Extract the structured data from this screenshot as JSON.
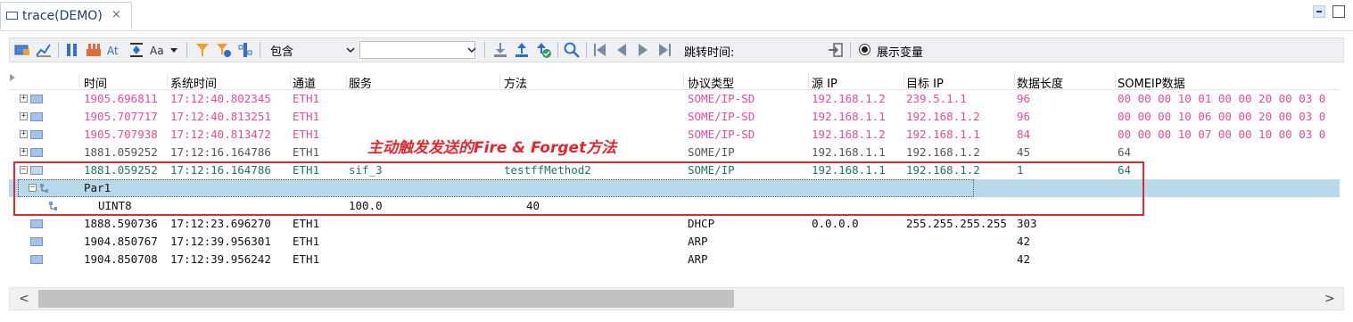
{
  "tab": {
    "title": "trace(DEMO)",
    "close": "×"
  },
  "toolbar": {
    "filter_mode": "包含",
    "search_value": "",
    "jump_label": "跳转时间:",
    "show_vars_label": "展示变量"
  },
  "table": {
    "columns": [
      "时间",
      "系统时间",
      "通道",
      "服务",
      "方法",
      "协议类型",
      "源 IP",
      "目标 IP",
      "数据长度",
      "SOMEIP数据"
    ],
    "rows": [
      {
        "time": "1905.696811",
        "sys": "17:12:40.802345",
        "ch": "ETH1",
        "svc": "",
        "method": "",
        "proto": "SOME/IP-SD",
        "src": "192.168.1.2",
        "dst": "239.5.1.1",
        "len": "96",
        "data": "00 00 00 10 01 00 00 20 00 03 0"
      },
      {
        "time": "1905.707717",
        "sys": "17:12:40.813251",
        "ch": "ETH1",
        "svc": "",
        "method": "",
        "proto": "SOME/IP-SD",
        "src": "192.168.1.1",
        "dst": "192.168.1.2",
        "len": "96",
        "data": "00 00 00 10 06 00 00 20 00 03 0"
      },
      {
        "time": "1905.707938",
        "sys": "17:12:40.813472",
        "ch": "ETH1",
        "svc": "",
        "method": "",
        "proto": "SOME/IP-SD",
        "src": "192.168.1.2",
        "dst": "192.168.1.1",
        "len": "84",
        "data": "00 00 00 10 07 00 00 10 00 03 0"
      },
      {
        "time": "1881.059252",
        "sys": "17:12:16.164786",
        "ch": "ETH1",
        "svc": "",
        "method": "",
        "proto": "SOME/IP",
        "src": "192.168.1.1",
        "dst": "192.168.1.2",
        "len": "45",
        "data": "64"
      },
      {
        "time": "1881.059252",
        "sys": "17:12:16.164786",
        "ch": "ETH1",
        "svc": "sif_3",
        "method": "testffMethod2",
        "proto": "SOME/IP",
        "src": "192.168.1.1",
        "dst": "192.168.1.2",
        "len": "1",
        "data": "64"
      },
      {
        "param": "Par1"
      },
      {
        "subparam": "UINT8",
        "val1": "100.0",
        "val2": "40"
      },
      {
        "time": "1888.590736",
        "sys": "17:12:23.696270",
        "ch": "ETH1",
        "svc": "",
        "method": "",
        "proto": "DHCP",
        "src": "0.0.0.0",
        "dst": "255.255.255.255",
        "len": "303",
        "data": ""
      },
      {
        "time": "1904.850767",
        "sys": "17:12:39.956301",
        "ch": "ETH1",
        "svc": "",
        "method": "",
        "proto": "ARP",
        "src": "",
        "dst": "",
        "len": "42",
        "data": ""
      },
      {
        "time": "1904.850708",
        "sys": "17:12:39.956242",
        "ch": "ETH1",
        "svc": "",
        "method": "",
        "proto": "ARP",
        "src": "",
        "dst": "",
        "len": "42",
        "data": ""
      }
    ]
  },
  "annotation": {
    "text": "主动触发发送的Fire & Forget方法"
  },
  "scroll": {
    "left": "<",
    "right": ">"
  },
  "colors": {
    "pink": "#e34b9b",
    "green": "#187a5a",
    "highlight": "#b8d9ea",
    "annotation": "#e0282e"
  }
}
